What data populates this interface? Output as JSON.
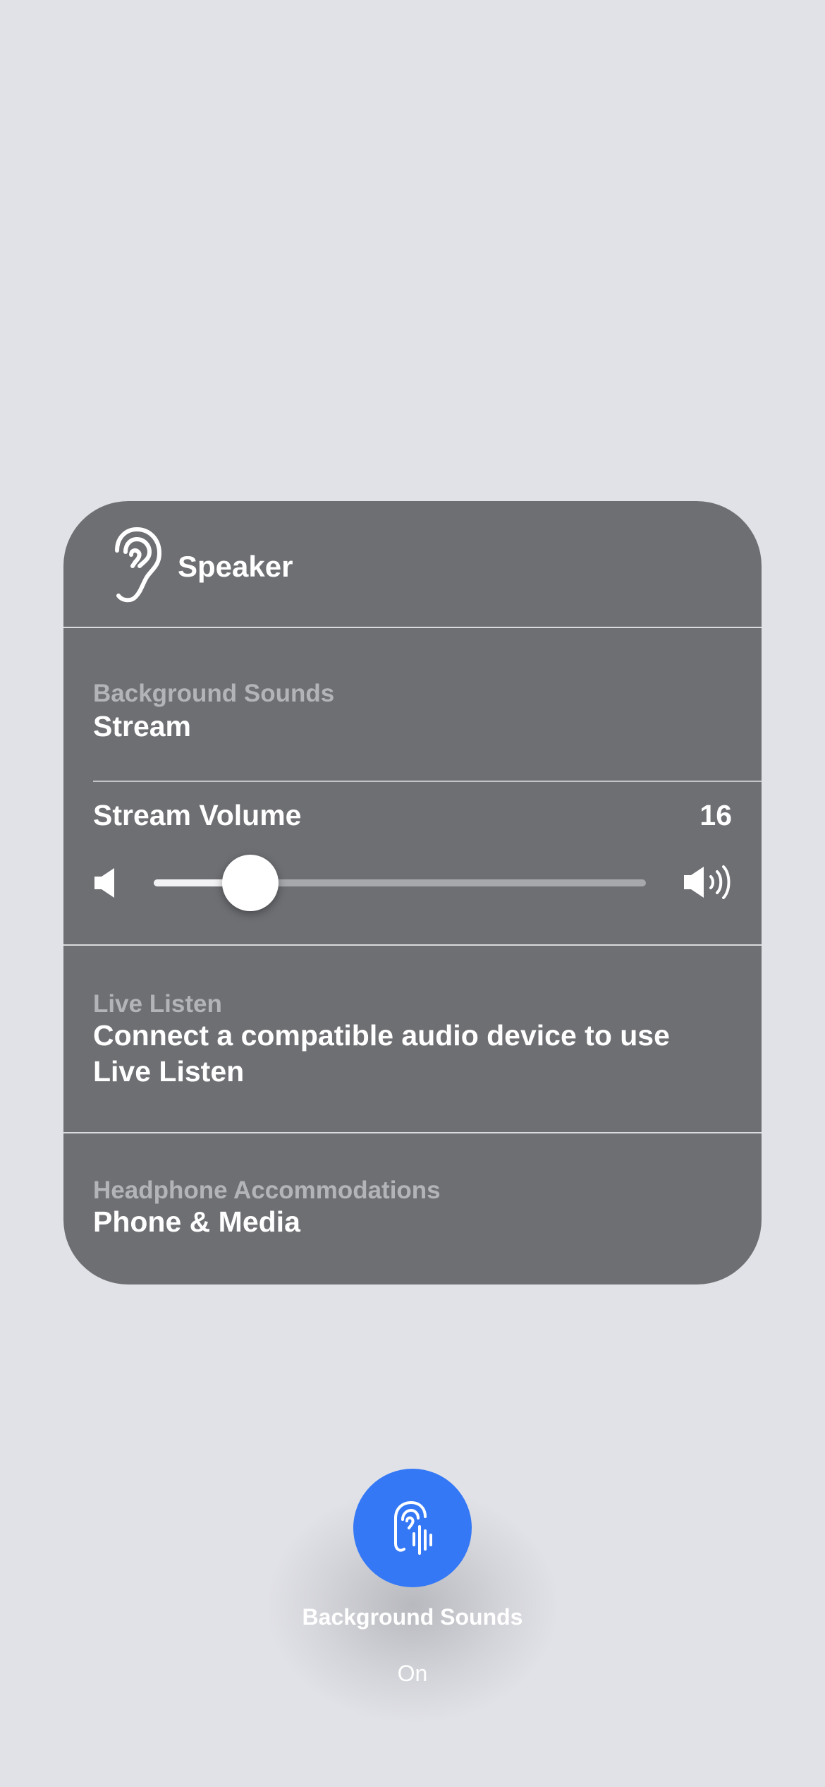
{
  "panel": {
    "title": "Speaker",
    "icon": "ear-icon"
  },
  "background_sounds_row": {
    "label": "Background Sounds",
    "value": "Stream"
  },
  "stream_volume": {
    "label": "Stream Volume",
    "value": "16",
    "level_fraction": 0.196,
    "min_icon": "speaker-low-icon",
    "max_icon": "speaker-high-icon"
  },
  "live_listen_row": {
    "label": "Live Listen",
    "value": "Connect a compatible audio device to use Live Listen"
  },
  "headphone_row": {
    "label": "Headphone Accommodations",
    "value": "Phone & Media"
  },
  "background_sounds_toggle": {
    "title": "Background Sounds",
    "state": "On",
    "color": "#3478f6",
    "icon": "ear-waveform-icon"
  },
  "colors": {
    "background": "#e1e2e7",
    "panel": "#6e6f73",
    "accent": "#3478f6"
  }
}
